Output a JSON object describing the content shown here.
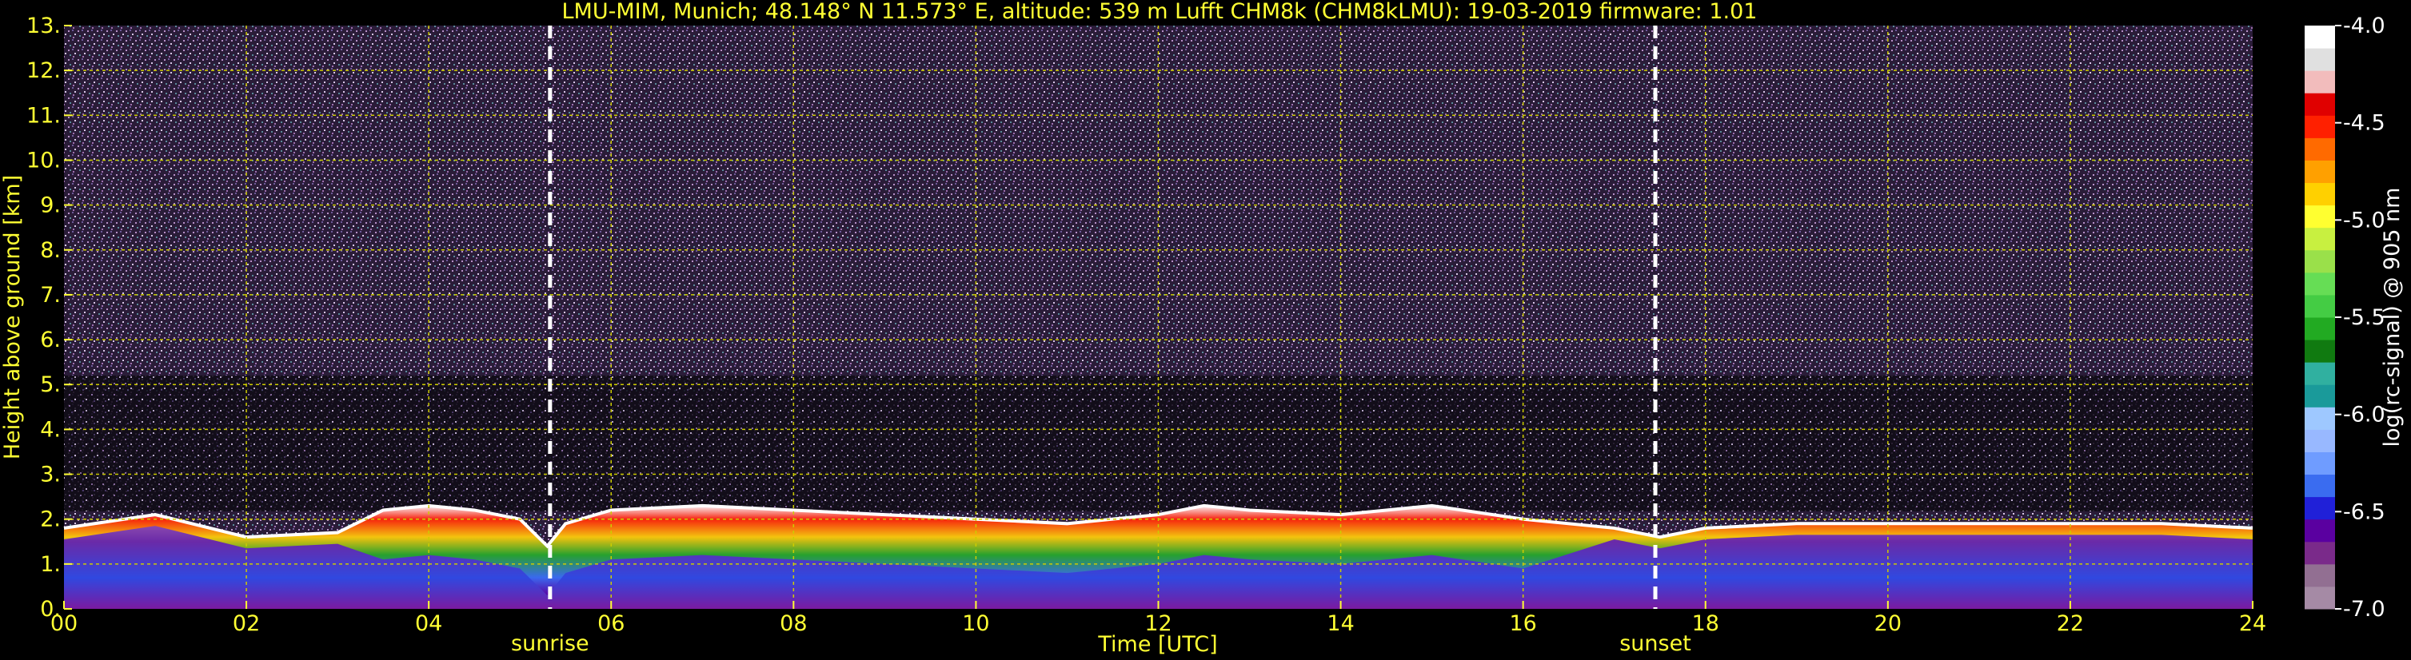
{
  "chart_data": {
    "type": "heatmap",
    "title": "LMU-MIM, Munich; 48.148° N 11.573° E, altitude: 539 m    Lufft CHM8k (CHM8kLMU): 19-03-2019    firmware: 1.01",
    "xlabel": "Time [UTC]",
    "ylabel": "Height above ground [km]",
    "xlim": [
      0,
      24
    ],
    "ylim": [
      0,
      13
    ],
    "x_ticks": [
      0,
      2,
      4,
      6,
      8,
      10,
      12,
      14,
      16,
      18,
      20,
      22,
      24
    ],
    "x_tick_labels": [
      "00",
      "02",
      "04",
      "06",
      "08",
      "10",
      "12",
      "14",
      "16",
      "18",
      "20",
      "22",
      "24"
    ],
    "y_ticks": [
      0,
      1,
      2,
      3,
      4,
      5,
      6,
      7,
      8,
      9,
      10,
      11,
      12,
      13
    ],
    "y_tick_labels": [
      "0.",
      "1.",
      "2.",
      "3.",
      "4.",
      "5.",
      "6.",
      "7.",
      "8.",
      "9.",
      "10.",
      "11.",
      "12.",
      "13."
    ],
    "grid": true,
    "annotations": [
      {
        "label": "sunrise",
        "x": 5.33
      },
      {
        "label": "sunset",
        "x": 17.45
      }
    ],
    "colorbar": {
      "label": "log(rc-signal) @ 905 nm",
      "range": [
        -7.0,
        -4.0
      ],
      "ticks": [
        -4.0,
        -4.5,
        -5.0,
        -5.5,
        -6.0,
        -6.5,
        -7.0
      ],
      "tick_labels": [
        "-4.0",
        "-4.5",
        "-5.0",
        "-5.5",
        "-6.0",
        "-6.5",
        "-7.0"
      ],
      "colors": [
        "#a58aa5",
        "#926f92",
        "#7a2a8a",
        "#5a00a0",
        "#2020d8",
        "#3a6cf0",
        "#6f9cff",
        "#98b8ff",
        "#9ec8ff",
        "#1a9a9a",
        "#30b0a0",
        "#107a10",
        "#22aa22",
        "#44cc44",
        "#66dd55",
        "#9ae04a",
        "#c8f040",
        "#ffff30",
        "#ffd000",
        "#ffa000",
        "#ff6a00",
        "#ff2000",
        "#e00000",
        "#f2bcbc",
        "#e0e0e0",
        "#ffffff"
      ]
    },
    "series": [
      {
        "name": "",
        "description_values": "boundary-layer aerosol top height [km] over time",
        "x": [
          0,
          1,
          2,
          3,
          3.5,
          4,
          4.5,
          5,
          5.3,
          5.5,
          6,
          7,
          8,
          9,
          10,
          11,
          12,
          12.5,
          13,
          14,
          15,
          16,
          17,
          17.5,
          18,
          19,
          20,
          21,
          22,
          23,
          24
        ],
        "y": [
          1.8,
          2.1,
          1.6,
          1.7,
          2.2,
          2.3,
          2.2,
          2.0,
          1.4,
          1.9,
          2.2,
          2.3,
          2.2,
          2.1,
          2.0,
          1.9,
          2.1,
          2.3,
          2.2,
          2.1,
          2.3,
          2.0,
          1.8,
          1.6,
          1.8,
          1.9,
          1.9,
          1.9,
          1.9,
          1.9,
          1.8
        ]
      }
    ]
  }
}
